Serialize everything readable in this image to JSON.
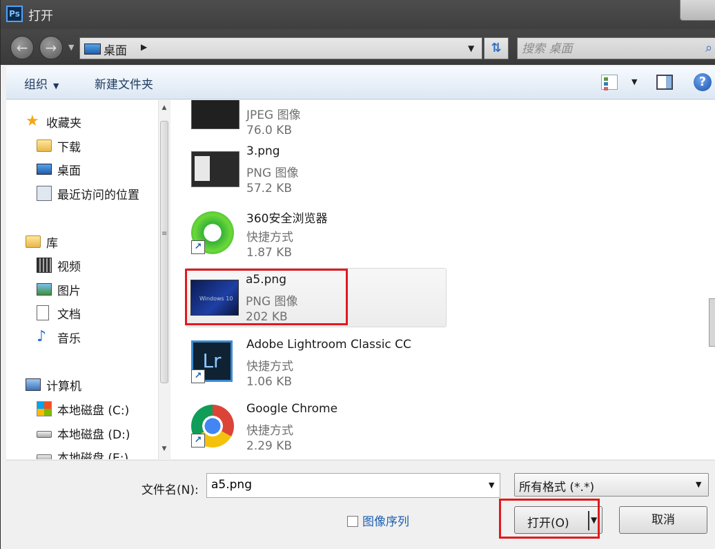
{
  "window": {
    "title": "打开",
    "app_icon_label": "Ps"
  },
  "address": {
    "location": "桌面",
    "search_placeholder": "搜索 桌面"
  },
  "toolbar": {
    "organize_label": "组织",
    "new_folder_label": "新建文件夹"
  },
  "nav": {
    "favorites": {
      "label": "收藏夹",
      "items": [
        "下载",
        "桌面",
        "最近访问的位置"
      ]
    },
    "libraries": {
      "label": "库",
      "items": [
        "视频",
        "图片",
        "文档",
        "音乐"
      ]
    },
    "computer": {
      "label": "计算机",
      "items": [
        "本地磁盘 (C:)",
        "本地磁盘 (D:)",
        "本地磁盘 (E:)"
      ]
    }
  },
  "files": [
    {
      "name": "",
      "type": "JPEG 图像",
      "size": "76.0 KB"
    },
    {
      "name": "3.png",
      "type": "PNG 图像",
      "size": "57.2 KB"
    },
    {
      "name": "360安全浏览器",
      "type": "快捷方式",
      "size": "1.87 KB"
    },
    {
      "name": "a5.png",
      "type": "PNG 图像",
      "size": "202 KB",
      "selected": true,
      "thumb_text": "Windows 10"
    },
    {
      "name": "Adobe Lightroom Classic CC",
      "type": "快捷方式",
      "size": "1.06 KB",
      "thumb_text": "Lr"
    },
    {
      "name": "Google Chrome",
      "type": "快捷方式",
      "size": "2.29 KB"
    }
  ],
  "bottom": {
    "filename_label": "文件名(N):",
    "filename_value": "a5.png",
    "filetype_value": "所有格式 (*.*)",
    "image_sequence_label": "图像序列",
    "open_label": "打开(O)",
    "cancel_label": "取消"
  },
  "colors": {
    "highlight": "#e3181c",
    "link": "#1d5fb0"
  }
}
